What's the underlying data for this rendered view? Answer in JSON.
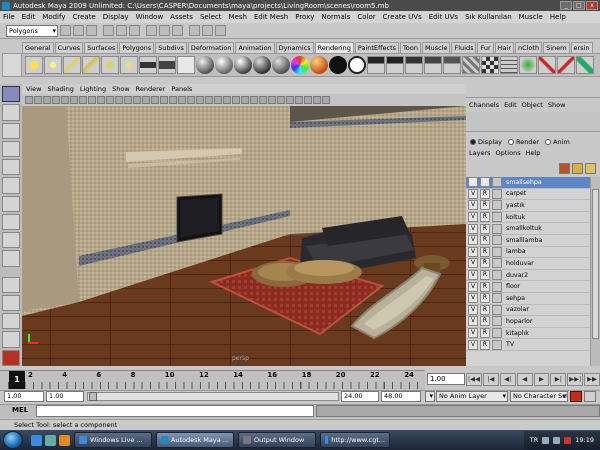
{
  "window": {
    "title": "Autodesk Maya 2009 Unlimited: C:\\Users\\CASPER\\Documents\\maya\\projects\\LivingRoom\\scenes\\room5.mb"
  },
  "menus": [
    "File",
    "Edit",
    "Modify",
    "Create",
    "Display",
    "Window",
    "Assets",
    "Select",
    "Mesh",
    "Edit Mesh",
    "Proxy",
    "Normals",
    "Color",
    "Create UVs",
    "Edit UVs",
    "Sık Kullanılan",
    "Muscle",
    "Help"
  ],
  "status_line": {
    "mode": "Polygons"
  },
  "shelf_tabs": [
    "General",
    "Curves",
    "Surfaces",
    "Polygons",
    "Subdivs",
    "Deformation",
    "Animation",
    "Dynamics",
    "Rendering",
    "PaintEffects",
    "Toon",
    "Muscle",
    "Fluids",
    "Fur",
    "Hair",
    "nCloth",
    "Sinem",
    "ersin"
  ],
  "active_shelf": "Rendering",
  "panel_menu": [
    "View",
    "Shading",
    "Lighting",
    "Show",
    "Renderer",
    "Panels"
  ],
  "channel_box": {
    "menu": [
      "Channels",
      "Edit",
      "Object",
      "Show"
    ]
  },
  "layer_editor": {
    "radios": [
      "Display",
      "Render",
      "Anim"
    ],
    "selected_radio": "Display",
    "menu": [
      "Layers",
      "Options",
      "Help"
    ],
    "visible_mark": "V",
    "ref_mark": "R",
    "layers": [
      "smallsehpa",
      "carpet",
      "yastık",
      "koltuk",
      "smallkoltuk",
      "smalllamba",
      "lamba",
      "holduvar",
      "duvar2",
      "floor",
      "sehpa",
      "vazolar",
      "hoparlor",
      "kitaplık",
      "TV"
    ],
    "selected_layer": "smallsehpa"
  },
  "timeline": {
    "current_frame": "1",
    "tick_labels": [
      "2",
      "4",
      "6",
      "8",
      "10",
      "12",
      "14",
      "16",
      "18",
      "20",
      "22",
      "24"
    ],
    "current_time": "1.00"
  },
  "playback_controls": [
    "|◀◀",
    "|◀",
    "◀|",
    "◀",
    "▶",
    "▶|",
    "▶▶|",
    "▶▶"
  ],
  "range": {
    "start": "1.00",
    "inner_start": "1.00",
    "inner_end": "24.00",
    "end": "48.00",
    "anim_layer": "No Anim Layer",
    "char_set": "No Character Set"
  },
  "command_line": {
    "label": "MEL",
    "value": ""
  },
  "help_line": "Select Tool: select a component",
  "viewport": {
    "label": "persp"
  },
  "taskbar": {
    "buttons": [
      "Windows Live ...",
      "Autodesk Maya ...",
      "Output Window",
      "http://www.cgt..."
    ],
    "active": "Autodesk Maya ...",
    "language": "TR",
    "time": "19:19"
  }
}
